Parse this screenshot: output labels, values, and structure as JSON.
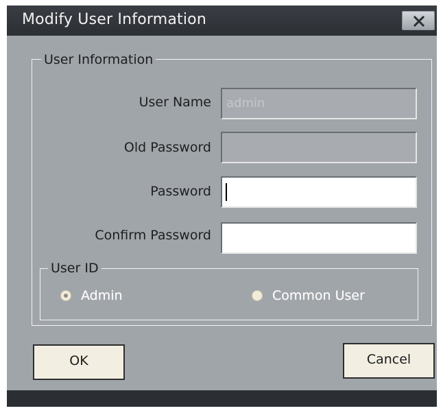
{
  "dialog": {
    "title": "Modify User Information",
    "close_icon": "close-icon"
  },
  "user_info": {
    "legend": "User Information",
    "user_name_label": "User Name",
    "user_name_value": "admin",
    "old_password_label": "Old Password",
    "password_label": "Password",
    "confirm_password_label": "Confirm Password"
  },
  "user_id": {
    "legend": "User ID",
    "options": [
      {
        "label": "Admin",
        "selected": true
      },
      {
        "label": "Common User",
        "selected": false
      }
    ]
  },
  "buttons": {
    "ok_label": "OK",
    "cancel_label": "Cancel"
  }
}
